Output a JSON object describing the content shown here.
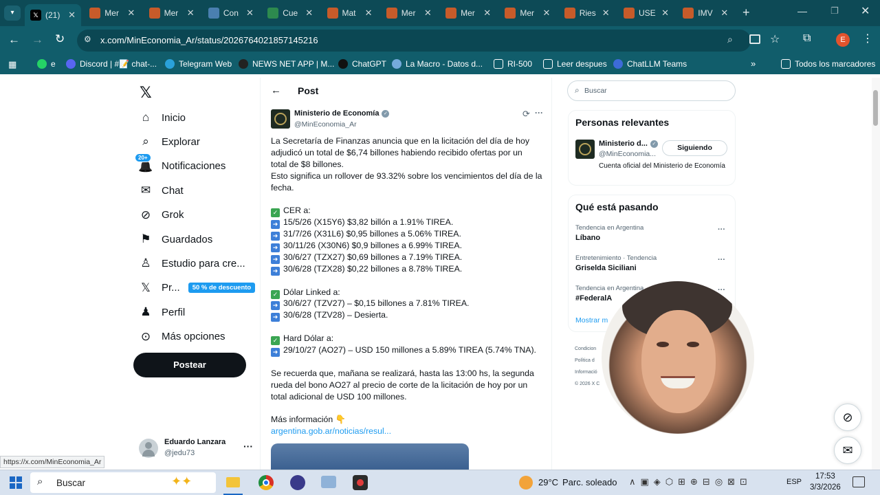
{
  "browser": {
    "tabs": [
      {
        "label": "(21)",
        "icon": "x-logo-icon",
        "active": true
      },
      {
        "label": "Mer",
        "icon": "web-icon"
      },
      {
        "label": "Mer",
        "icon": "web-icon"
      },
      {
        "label": "Con",
        "icon": "globe-icon"
      },
      {
        "label": "Cue",
        "icon": "sheet-icon"
      },
      {
        "label": "Mat",
        "icon": "web-icon"
      },
      {
        "label": "Mer",
        "icon": "web-icon"
      },
      {
        "label": "Mer",
        "icon": "web-icon"
      },
      {
        "label": "Mer",
        "icon": "web-icon"
      },
      {
        "label": "Ries",
        "icon": "web-icon"
      },
      {
        "label": "USE",
        "icon": "web-icon"
      },
      {
        "label": "IMV",
        "icon": "web-icon"
      }
    ],
    "url": "x.com/MinEconomia_Ar/status/2026764021857145216",
    "profile_initial": "E",
    "bookmarks": [
      {
        "label": "e"
      },
      {
        "label": "Discord | #📝 chat-..."
      },
      {
        "label": "Telegram Web"
      },
      {
        "label": "NEWS NET APP | M..."
      },
      {
        "label": "ChatGPT"
      },
      {
        "label": "La Macro - Datos d..."
      },
      {
        "label": "RI-500"
      },
      {
        "label": "Leer despues"
      },
      {
        "label": "ChatLLM Teams"
      }
    ],
    "all_bookmarks": "Todos los marcadores",
    "status_url": "https://x.com/MinEconomia_Ar"
  },
  "nav": {
    "items": [
      {
        "label": "Inicio"
      },
      {
        "label": "Explorar"
      },
      {
        "label": "Notificaciones",
        "badge": "20+"
      },
      {
        "label": "Chat"
      },
      {
        "label": "Grok"
      },
      {
        "label": "Guardados"
      },
      {
        "label": "Estudio para cre..."
      },
      {
        "label": "Pr...",
        "badge": "50 % de descuento"
      },
      {
        "label": "Perfil"
      },
      {
        "label": "Más opciones"
      }
    ],
    "post_button": "Postear",
    "user_name": "Eduardo Lanzara",
    "user_handle": "@jedu73"
  },
  "post": {
    "header": "Post",
    "author_name": "Ministerio de Economía",
    "author_handle": "@MinEconomia_Ar",
    "lines": [
      "La Secretaría de Finanzas anuncia que en la licitación del día de hoy",
      "adjudicó un total de $6,74 billones habiendo recibido ofertas por un",
      "total de $8 billones.",
      "Esto significa un rollover de 93.32% sobre los vencimientos del día de la",
      "fecha.",
      "",
      "CER a:",
      "15/5/26 (X15Y6) $3,82 billón a 1.91% TIREA.",
      "31/7/26 (X31L6) $0,95 billones a 5.06% TIREA.",
      "30/11/26 (X30N6) $0,9 billones a 6.99% TIREA.",
      "30/6/27 (TZX27) $0,69 billones a 7.19% TIREA.",
      "30/6/28 (TZX28) $0,22 billones a 8.78% TIREA.",
      "",
      "Dólar Linked a:",
      "30/6/27 (TZV27) – $0,15 billones a 7.81% TIREA.",
      "30/6/28 (TZV28) – Desierta.",
      "",
      "Hard Dólar a:",
      "29/10/27 (AO27) – USD 150 millones a 5.89% TIREA (5.74% TNA).",
      "",
      "Se recuerda que, mañana se realizará, hasta las 13:00 hs, la segunda",
      "rueda del bono AO27 al precio de corte de la licitación de hoy por un",
      "total adicional de USD 100 millones.",
      "",
      "Más información 👇",
      "argentina.gob.ar/noticias/resul..."
    ]
  },
  "sidebar": {
    "search_placeholder": "Buscar",
    "relevant_title": "Personas relevantes",
    "relevant_name": "Ministerio d...",
    "relevant_handle": "@MinEconomia...",
    "relevant_bio": "Cuenta oficial del Ministerio de Economía",
    "follow_label": "Siguiendo",
    "trending_title": "Qué está pasando",
    "trends": [
      {
        "meta": "Tendencia en Argentina",
        "title": "Líbano"
      },
      {
        "meta": "Entretenimiento · Tendencia",
        "title": "Griselda Siciliani"
      },
      {
        "meta": "Tendencia en Argentina",
        "title": "#FederalA"
      }
    ],
    "show_more": "Mostrar m",
    "footer_links": [
      "Condicion",
      "Política d",
      "Informació",
      "© 2026 X C"
    ]
  },
  "taskbar": {
    "search": "Buscar",
    "weather_temp": "29°C",
    "weather_text": "Parc. soleado",
    "lang": "ESP",
    "time": "17:53",
    "date": "3/3/2026"
  }
}
